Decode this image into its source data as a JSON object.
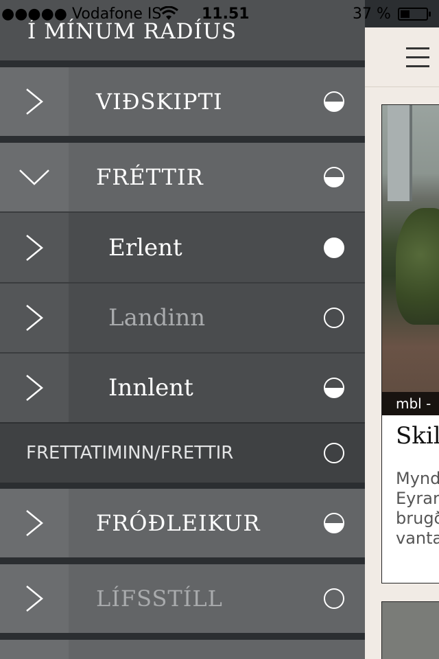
{
  "status_bar": {
    "carrier": "●●●●● Vodafone IS",
    "time": "11.51",
    "battery_text": "37 %",
    "battery_level": 0.37
  },
  "menu": {
    "title": "Í MÍNUM RADÍUS",
    "items": [
      {
        "label": "VIÐSKIPTI",
        "arrow": "chevron-right",
        "indicator": "half"
      },
      {
        "label": "FRÉTTIR",
        "arrow": "chevron-down",
        "indicator": "half"
      },
      {
        "label": "Erlent",
        "arrow": "chevron-right",
        "indicator": "full"
      },
      {
        "label": "Landinn",
        "arrow": "chevron-right",
        "indicator": "empty"
      },
      {
        "label": "Innlent",
        "arrow": "chevron-right",
        "indicator": "half"
      },
      {
        "label": "FRETTATIMINN/FRETTIR",
        "indicator": "empty"
      },
      {
        "label": "FRÓÐLEIKUR",
        "arrow": "chevron-right",
        "indicator": "half"
      },
      {
        "label": "LÍFSSTÍLL",
        "arrow": "chevron-right",
        "indicator": "empty"
      }
    ]
  },
  "content": {
    "menu_icon": "hamburger-icon",
    "card": {
      "source": "mbl -",
      "title": "Skil",
      "excerpt_lines": [
        "Mynd",
        "Eyrar",
        "brugð",
        "vanta"
      ]
    }
  }
}
